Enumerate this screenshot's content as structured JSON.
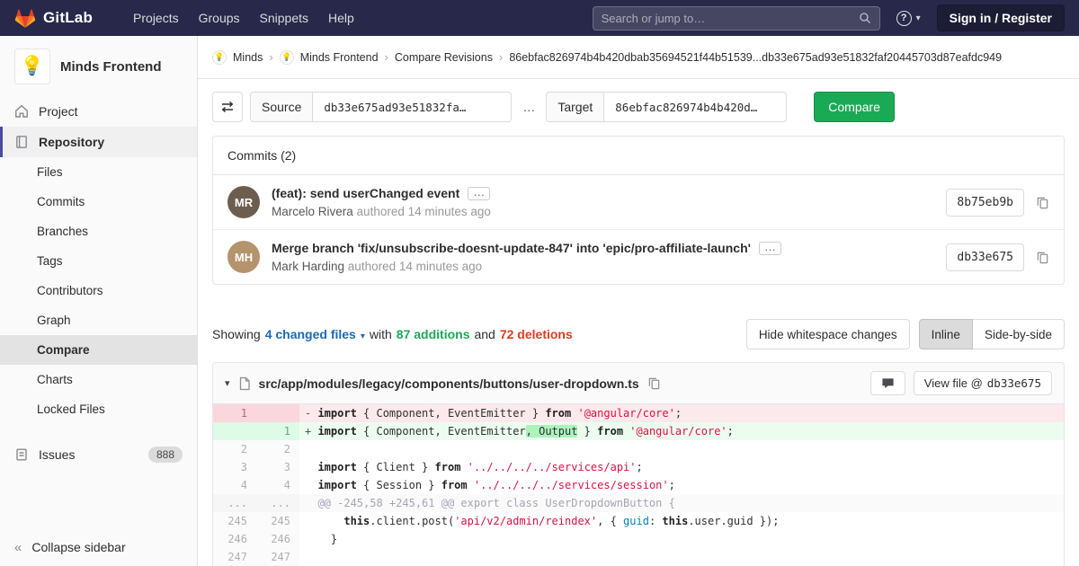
{
  "navbar": {
    "brand": "GitLab",
    "links": [
      "Projects",
      "Groups",
      "Snippets",
      "Help"
    ],
    "search_placeholder": "Search or jump to…",
    "signin_label": "Sign in / Register"
  },
  "icons": {
    "help": "?",
    "chevron_down": "▾",
    "collapse": "«",
    "ellipsis": "…",
    "caret_down": "▾"
  },
  "sidebar": {
    "avatar_emoji": "💡",
    "project_title": "Minds Frontend",
    "project_item": "Project",
    "repository_item": "Repository",
    "repo_subitems": [
      "Files",
      "Commits",
      "Branches",
      "Tags",
      "Contributors",
      "Graph",
      "Compare",
      "Charts",
      "Locked Files"
    ],
    "issues_label": "Issues",
    "issues_count": "888",
    "collapse_label": "Collapse sidebar"
  },
  "breadcrumb": {
    "logo_emoji": "💡",
    "separator": "›",
    "items": [
      "Minds",
      "Minds Frontend",
      "Compare Revisions"
    ],
    "current": "86ebfac826974b4b420dbab35694521f44b51539...db33e675ad93e51832faf20445703d87eafdc949"
  },
  "compare_form": {
    "source_label": "Source",
    "source_value": "db33e675ad93e51832fa…",
    "separator": "…",
    "target_label": "Target",
    "target_value": "86ebfac826974b4b420d…",
    "compare_button": "Compare"
  },
  "commits": {
    "header": "Commits (2)",
    "items": [
      {
        "title": "(feat): send userChanged event",
        "author": "Marcelo Rivera",
        "meta": "authored 14 minutes ago",
        "sha": "8b75eb9b",
        "initials": "MR"
      },
      {
        "title": "Merge branch 'fix/unsubscribe-doesnt-update-847' into 'epic/pro-affiliate-launch'",
        "author": "Mark Harding",
        "meta": "authored 14 minutes ago",
        "sha": "db33e675",
        "initials": "MH"
      }
    ]
  },
  "diff_summary": {
    "showing": "Showing",
    "changed_files": "4 changed files",
    "with": "with",
    "additions": "87 additions",
    "and": "and",
    "deletions": "72 deletions",
    "hide_whitespace": "Hide whitespace changes",
    "inline": "Inline",
    "side_by_side": "Side-by-side"
  },
  "diff_file": {
    "path": "src/app/modules/legacy/components/buttons/user-dropdown.ts",
    "view_file_label": "View file @",
    "view_file_sha": "db33e675",
    "lines": [
      {
        "type": "del",
        "old": "1",
        "new": "",
        "marker": "-",
        "segments": [
          [
            "import",
            "k"
          ],
          [
            " { Component, EventEmitter } ",
            "p"
          ],
          [
            "from",
            "k"
          ],
          [
            " ",
            "p"
          ],
          [
            "'@angular/core'",
            "s"
          ],
          [
            ";",
            "p"
          ]
        ]
      },
      {
        "type": "add",
        "old": "",
        "new": "1",
        "marker": "+",
        "segments": [
          [
            "import",
            "k"
          ],
          [
            " { Component, EventEmitter",
            "p"
          ],
          [
            ", Output",
            "hl"
          ],
          [
            " } ",
            "p"
          ],
          [
            "from",
            "k"
          ],
          [
            " ",
            "p"
          ],
          [
            "'@angular/core'",
            "s"
          ],
          [
            ";",
            "p"
          ]
        ]
      },
      {
        "type": "ctx",
        "old": "2",
        "new": "2",
        "marker": "",
        "segments": []
      },
      {
        "type": "ctx",
        "old": "3",
        "new": "3",
        "marker": "",
        "segments": [
          [
            "import",
            "k"
          ],
          [
            " { Client } ",
            "p"
          ],
          [
            "from",
            "k"
          ],
          [
            " ",
            "p"
          ],
          [
            "'../../../../services/api'",
            "s"
          ],
          [
            ";",
            "p"
          ]
        ]
      },
      {
        "type": "ctx",
        "old": "4",
        "new": "4",
        "marker": "",
        "segments": [
          [
            "import",
            "k"
          ],
          [
            " { Session } ",
            "p"
          ],
          [
            "from",
            "k"
          ],
          [
            " ",
            "p"
          ],
          [
            "'../../../../services/session'",
            "s"
          ],
          [
            ";",
            "p"
          ]
        ]
      },
      {
        "type": "match",
        "old": "...",
        "new": "...",
        "marker": "",
        "segments": [
          [
            "@@ -245,58 +245,61 @@ export class UserDropdownButton {",
            "m"
          ]
        ]
      },
      {
        "type": "ctx",
        "old": "245",
        "new": "245",
        "marker": "",
        "segments": [
          [
            "    ",
            "p"
          ],
          [
            "this",
            "k"
          ],
          [
            ".client.post(",
            "p"
          ],
          [
            "'api/v2/admin/reindex'",
            "s"
          ],
          [
            ", { ",
            "p"
          ],
          [
            "guid",
            "v"
          ],
          [
            ": ",
            "p"
          ],
          [
            "this",
            "k"
          ],
          [
            ".user.guid });",
            "p"
          ]
        ]
      },
      {
        "type": "ctx",
        "old": "246",
        "new": "246",
        "marker": "",
        "segments": [
          [
            "  }",
            "p"
          ]
        ]
      },
      {
        "type": "ctx",
        "old": "247",
        "new": "247",
        "marker": "",
        "segments": []
      }
    ]
  },
  "colors": {
    "navbar_bg": "#28284a",
    "accent_green": "#1aaa55",
    "accent_red": "#db3b21",
    "link_blue": "#1b69b6",
    "sidebar_active_indicator": "#4b4ba3",
    "string_red": "#dd1144",
    "variable_teal": "#0086b3",
    "add_line_bg": "#ecfdf0",
    "del_line_bg": "#fbe9eb",
    "word_add_bg": "#acf2bd"
  }
}
